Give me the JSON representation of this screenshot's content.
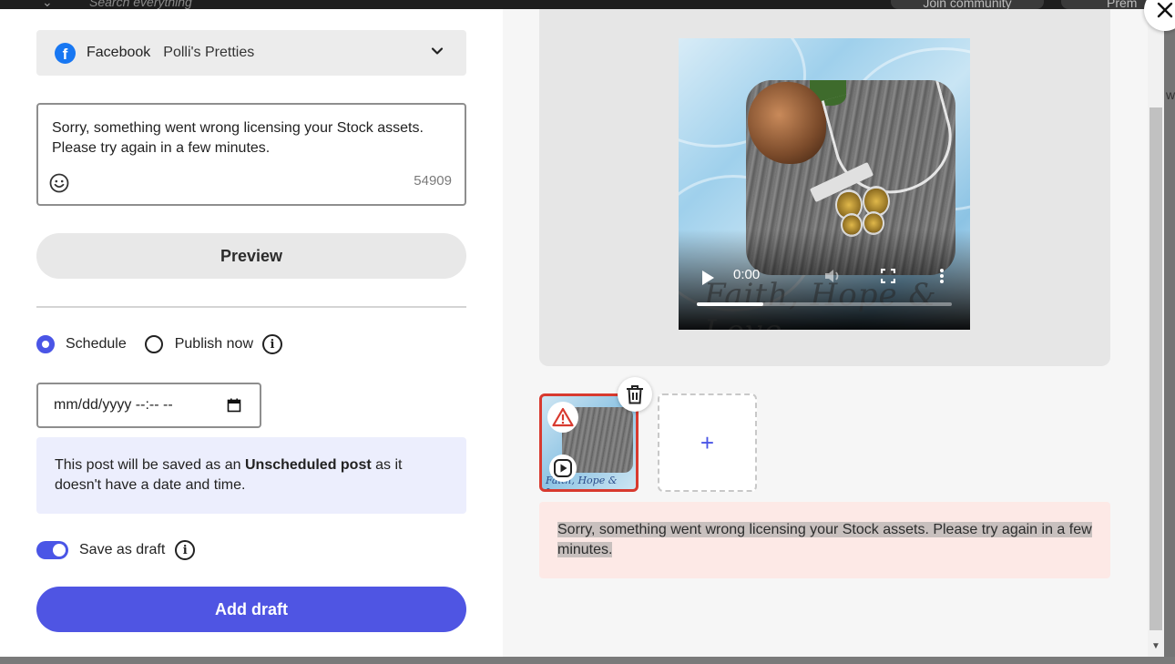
{
  "backdrop": {
    "search_placeholder": "Search everything",
    "join_label": "Join community",
    "premium_label": "Prem",
    "side_letter": "w"
  },
  "account": {
    "network": "Facebook",
    "page_name": "Polli's Pretties",
    "icon": "facebook-icon"
  },
  "caption": {
    "text": "Sorry, something went wrong licensing your Stock assets. Please try again in a few minutes.",
    "char_count": "54909"
  },
  "preview_label": "Preview",
  "publish": {
    "schedule_label": "Schedule",
    "publish_now_label": "Publish now",
    "selected": "schedule"
  },
  "datetime": {
    "placeholder": "mm/dd/yyyy --:-- --"
  },
  "notice": {
    "prefix": "This post will be saved as an ",
    "bold": "Unscheduled post",
    "suffix": " as it doesn't have a date and time."
  },
  "draft": {
    "label": "Save as draft",
    "enabled": true
  },
  "add_draft_label": "Add draft",
  "video": {
    "time": "0:00",
    "progress": 0.26,
    "overlay_text": "Faith, Hope & Love"
  },
  "media": {
    "thumb_caption": "Faith, Hope & Love",
    "add_symbol": "+"
  },
  "error_message": "Sorry, something went wrong licensing your Stock assets. Please try again in a few minutes.",
  "colors": {
    "accent": "#4f55e3",
    "error_border": "#d83a2f",
    "error_bg": "#fde9e6",
    "notice_bg": "#eceefd"
  }
}
